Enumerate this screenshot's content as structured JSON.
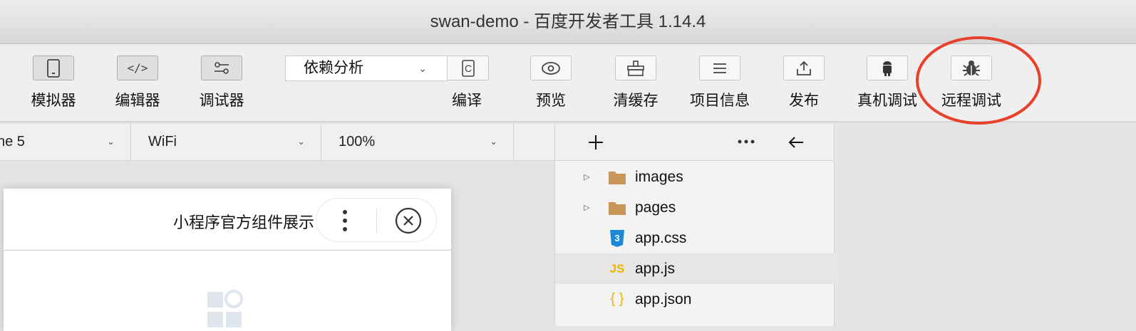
{
  "window": {
    "title": "swan-demo - 百度开发者工具 1.14.4"
  },
  "toolbar": {
    "simulator": "模拟器",
    "editor": "编辑器",
    "debugger": "调试器",
    "mode_select": "依赖分析",
    "compile": "编译",
    "preview": "预览",
    "clear_cache": "清缓存",
    "project_info": "项目信息",
    "publish": "发布",
    "device_debug": "真机调试",
    "remote_debug": "远程调试"
  },
  "simulator_bar": {
    "device": "ne 5",
    "network": "WiFi",
    "zoom": "100%"
  },
  "phone": {
    "nav_title": "小程序官方组件展示"
  },
  "file_tree": {
    "items": [
      {
        "name": "images",
        "type": "folder"
      },
      {
        "name": "pages",
        "type": "folder"
      },
      {
        "name": "app.css",
        "type": "css"
      },
      {
        "name": "app.js",
        "type": "js"
      },
      {
        "name": "app.json",
        "type": "json"
      }
    ]
  },
  "colors": {
    "highlight": "#e8412b",
    "folder": "#c8955a",
    "css": "#1e88d8",
    "js": "#f0b400"
  }
}
